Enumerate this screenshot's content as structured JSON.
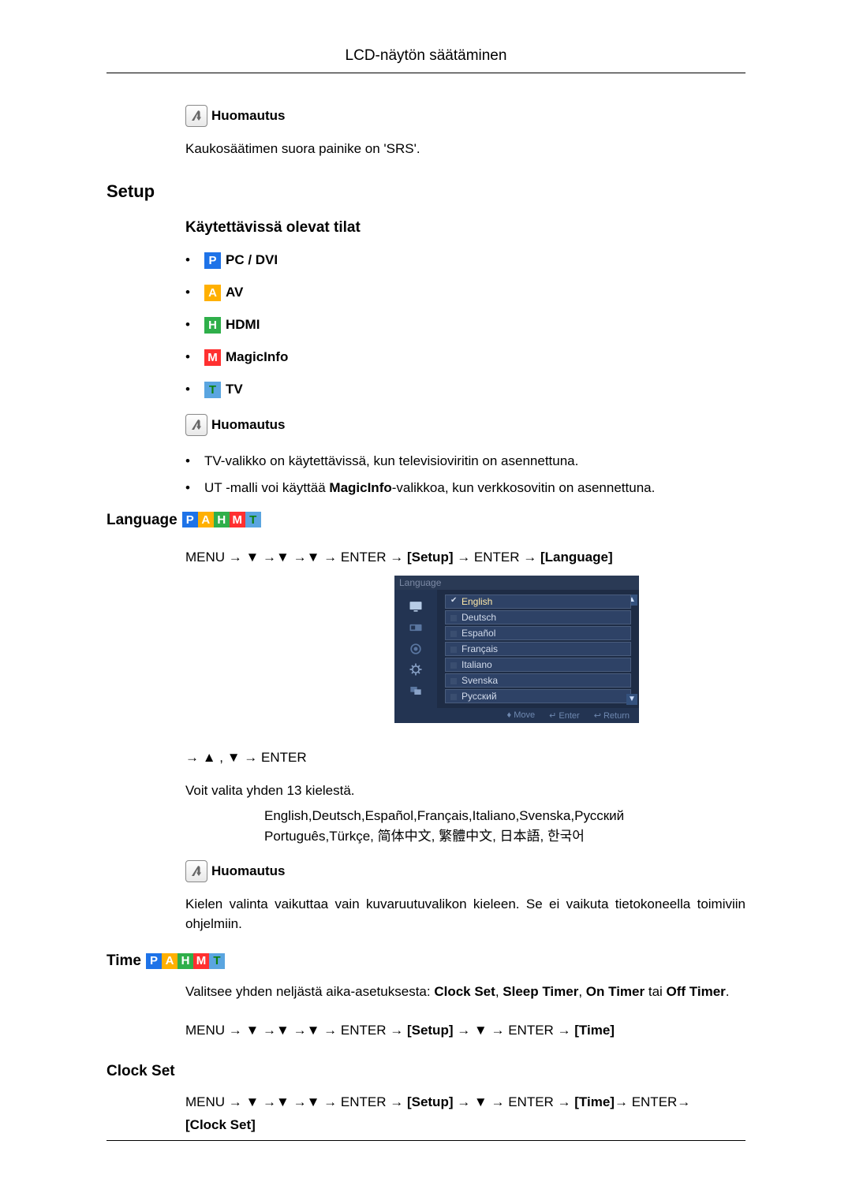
{
  "header": {
    "title": "LCD-näytön säätäminen"
  },
  "note_label": "Huomautus",
  "srs_note": "Kaukosäätimen suora painike on 'SRS'.",
  "setup": {
    "heading": "Setup",
    "modes_heading": "Käytettävissä olevat tilat",
    "modes": [
      {
        "code": "P",
        "label": "PC / DVI",
        "cls": "mode-P"
      },
      {
        "code": "A",
        "label": "AV",
        "cls": "mode-A"
      },
      {
        "code": "H",
        "label": "HDMI",
        "cls": "mode-H"
      },
      {
        "code": "M",
        "label": "MagicInfo",
        "cls": "mode-M"
      },
      {
        "code": "T",
        "label": "TV",
        "cls": "mode-T"
      }
    ],
    "mode_notes": [
      "TV-valikko on käytettävissä, kun televisioviritin on asennettuna.",
      "UT -malli voi käyttää MagicInfo-valikkoa, kun verkkosovitin on asennettuna."
    ]
  },
  "language": {
    "heading": "Language",
    "path1_a": "MENU → ▼ →▼ →▼ → ENTER → ",
    "path1_b": "[Setup]",
    "path1_c": " → ENTER → ",
    "path1_d": "[Language]",
    "osd_title": "Language",
    "osd_items": [
      "English",
      "Deutsch",
      "Español",
      "Français",
      "Italiano",
      "Svenska",
      "Русский"
    ],
    "osd_footer": {
      "move": "Move",
      "enter": "Enter",
      "return": "Return"
    },
    "osd_footer_icons": {
      "move": "♦",
      "enter": "↵",
      "return": "↩"
    },
    "path2": "→ ▲ , ▼ → ENTER",
    "choose_text": "Voit valita yhden 13 kielestä.",
    "lang_line1": "English,Deutsch,Español,Français,Italiano,Svenska,Русский",
    "lang_line2": "Português,Türkçe, 简体中文,  繁體中文, 日本語, 한국어",
    "effect_note": "Kielen valinta vaikuttaa vain kuvaruutuvalikon kieleen. Se ei vaikuta tietokoneella toimiviin ohjelmiin."
  },
  "time": {
    "heading": "Time",
    "desc_a": "Valitsee yhden neljästä aika-asetuksesta: ",
    "desc_b": "Clock Set",
    "desc_c": ", ",
    "desc_d": "Sleep Timer",
    "desc_e": ", ",
    "desc_f": "On Timer",
    "desc_g": " tai ",
    "desc_h": "Off Timer",
    "desc_i": ".",
    "path_a": "MENU → ▼ →▼ →▼ → ENTER → ",
    "path_b": "[Setup]",
    "path_c": " → ▼ → ENTER → ",
    "path_d": "[Time]"
  },
  "clock_set": {
    "heading": "Clock Set",
    "path_a": "MENU → ▼ →▼ →▼ → ENTER → ",
    "path_b": "[Setup]",
    "path_c": " → ▼ → ENTER → ",
    "path_d": "[Time]",
    "path_e": "→ ENTER→ ",
    "path_f": "[Clock Set]"
  }
}
